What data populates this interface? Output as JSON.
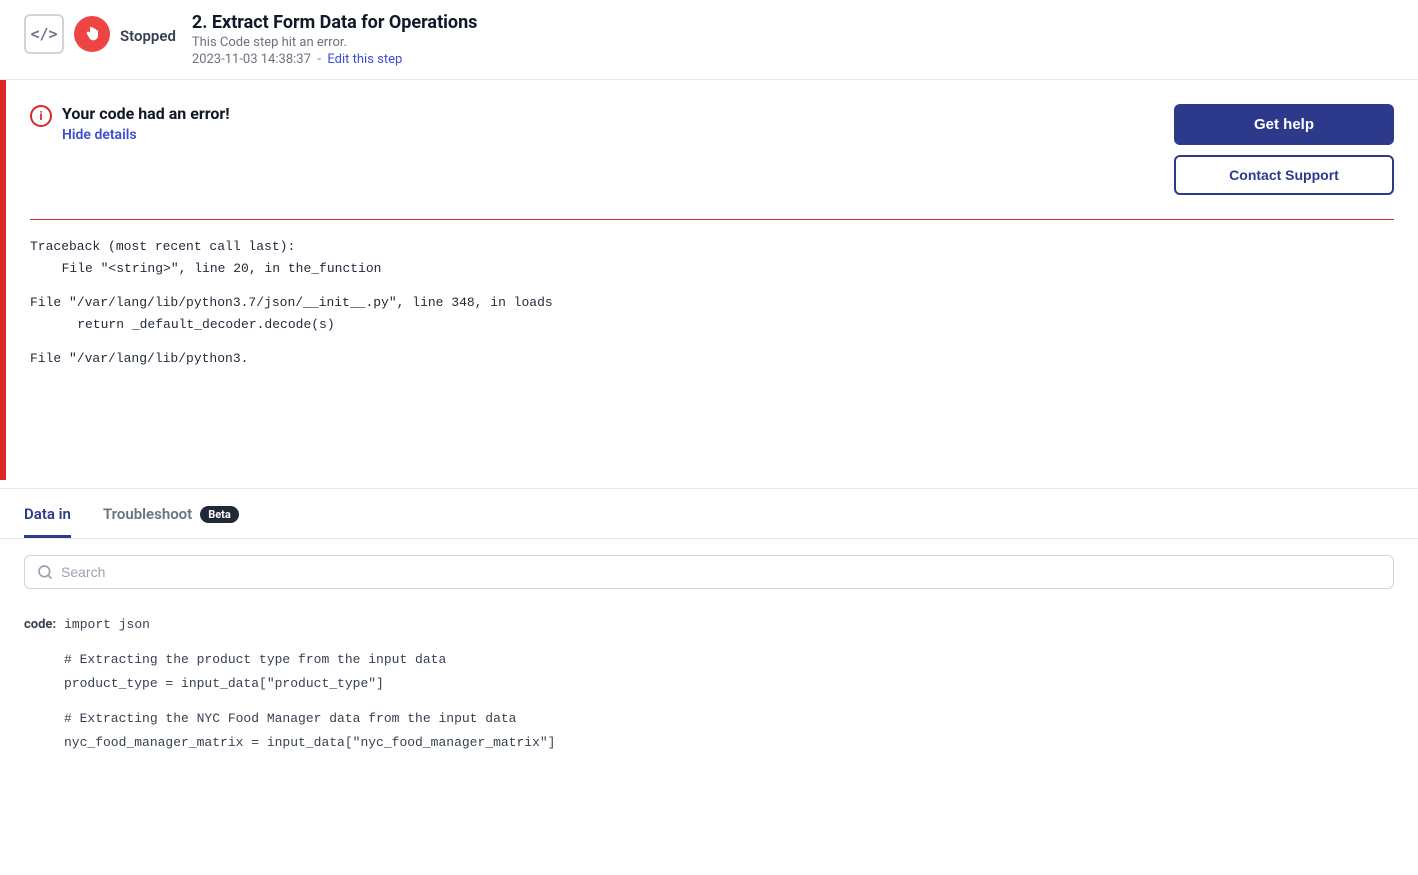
{
  "step": {
    "number": "2",
    "title": "Extract Form Data for Operations",
    "status": "Stopped",
    "error_msg": "This Code step hit an error.",
    "timestamp": "2023-11-03 14:38:37",
    "edit_link_text": "Edit this step"
  },
  "error_panel": {
    "title": "Your code had an error!",
    "hide_details_label": "Hide details",
    "get_help_label": "Get help",
    "contact_support_label": "Contact Support"
  },
  "traceback": {
    "line1": "Traceback (most recent call last):",
    "line2": "  File \"<string>\", line 20, in the_function",
    "line3": "File \"/var/lang/lib/python3.7/json/__init__.py\", line 348, in loads",
    "line4": "    return _default_decoder.decode(s)",
    "line5": "File \"/var/lang/lib/python3."
  },
  "tabs": {
    "data_in_label": "Data in",
    "troubleshoot_label": "Troubleshoot",
    "beta_label": "Beta",
    "active": "data_in"
  },
  "search": {
    "placeholder": "Search"
  },
  "code_display": {
    "label": "code:",
    "line1": "import json",
    "line2": "# Extracting the product type from the input data",
    "line3": "product_type = input_data[\"product_type\"]",
    "line4": "# Extracting the NYC Food Manager data from the input data",
    "line5": "nyc_food_manager_matrix = input_data[\"nyc_food_manager_matrix\"]"
  }
}
